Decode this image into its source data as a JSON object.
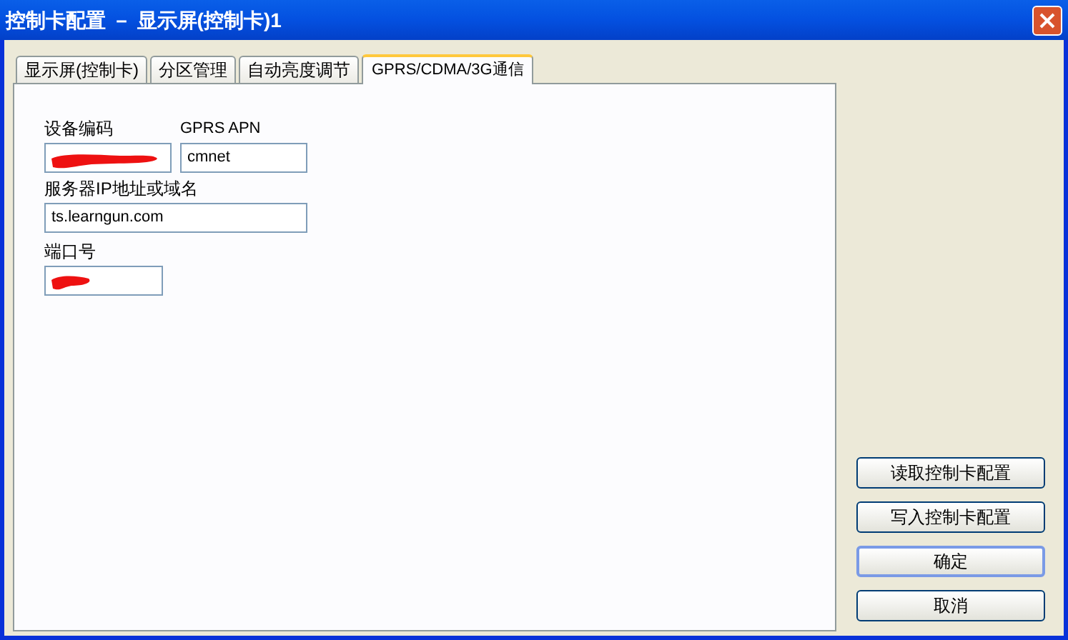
{
  "window": {
    "title": "控制卡配置 － 显示屏(控制卡)1"
  },
  "tabs": [
    {
      "label": "显示屏(控制卡)",
      "selected": false
    },
    {
      "label": "分区管理",
      "selected": false
    },
    {
      "label": "自动亮度调节",
      "selected": false
    },
    {
      "label": "GPRS/CDMA/3G通信",
      "selected": true
    }
  ],
  "fields": [
    {
      "label": "设备编码",
      "redacted": true
    },
    {
      "label": "GPRS APN",
      "value": "cmnet",
      "redacted": false
    },
    {
      "label": "服务器IP地址或域名",
      "value": "ts.learngun.com",
      "redacted": false
    },
    {
      "label": "端口号",
      "redacted": true
    }
  ],
  "buttons": [
    {
      "label": "读取控制卡配置",
      "default": false
    },
    {
      "label": "写入控制卡配置",
      "default": false
    },
    {
      "label": "确定",
      "default": true
    },
    {
      "label": "取消",
      "default": false
    }
  ]
}
